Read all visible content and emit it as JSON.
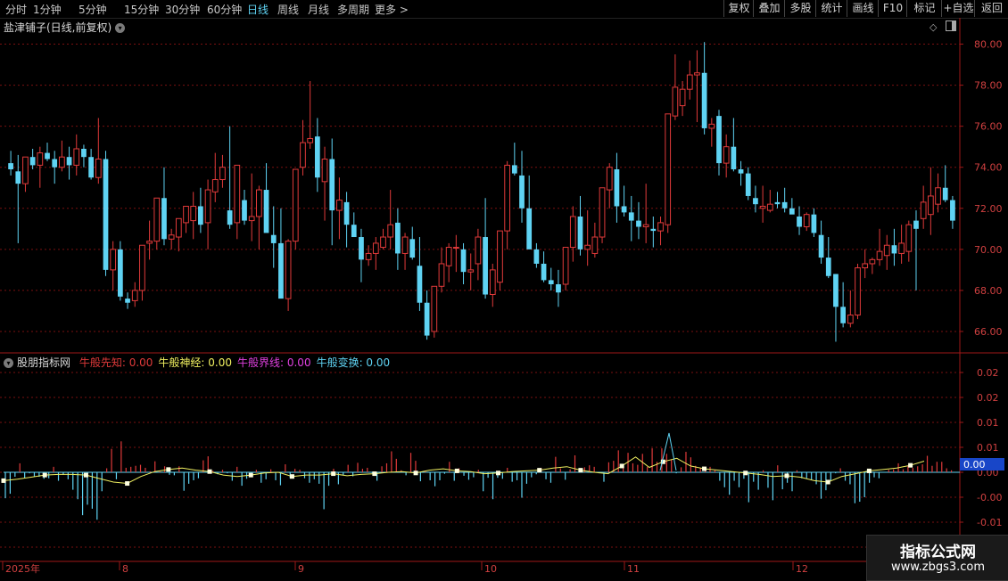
{
  "toolbar": {
    "periods": [
      "分时",
      "1分钟",
      "5分钟",
      "15分钟",
      "30分钟",
      "60分钟",
      "日线",
      "周线",
      "月线",
      "多周期",
      "更多 >"
    ],
    "active_period": "日线",
    "right_buttons": [
      "复权",
      "叠加",
      "多股",
      "统计",
      "画线",
      "F10",
      "标记",
      "+自选",
      "返回"
    ]
  },
  "stock": {
    "title": "盐津铺子(日线,前复权)"
  },
  "price_axis": [
    "80.00",
    "78.00",
    "76.00",
    "74.00",
    "72.00",
    "70.00",
    "68.00",
    "66.00"
  ],
  "indicator": {
    "name": "股朋指标网",
    "items": [
      {
        "label": "牛般先知: 0.00",
        "color": "#e03a3a"
      },
      {
        "label": "牛般神经: 0.00",
        "color": "#f0f060"
      },
      {
        "label": "牛般界线: 0.00",
        "color": "#e040e0"
      },
      {
        "label": "牛般变换: 0.00",
        "color": "#5fd3f3"
      }
    ],
    "axis": [
      "0.02",
      "0.02",
      "0.01",
      "0.01",
      "0.00",
      "-0.00",
      "-0.01",
      "-0.01"
    ],
    "current_value": "0.00"
  },
  "date_axis": [
    "2025年",
    "8",
    "9",
    "10",
    "11",
    "12"
  ],
  "watermark": {
    "line1": "指标公式网",
    "line2": "www.zbgs3.com"
  },
  "colors": {
    "up": "#e03a3a",
    "down": "#5fd3f3",
    "grid": "#7a1010",
    "accent": "#5fd3f3"
  },
  "chart_data": {
    "type": "candlestick",
    "ylim": [
      65.0,
      80.5
    ],
    "candles": [
      [
        74.2,
        74.8,
        73.6,
        73.9
      ],
      [
        73.8,
        74.6,
        70.3,
        73.2
      ],
      [
        73.2,
        74.5,
        72.8,
        74.5
      ],
      [
        74.5,
        74.9,
        73.9,
        74.1
      ],
      [
        74.1,
        75.0,
        73.0,
        74.7
      ],
      [
        74.7,
        75.2,
        74.3,
        74.4
      ],
      [
        74.4,
        74.8,
        73.2,
        74.0
      ],
      [
        74.0,
        75.3,
        73.8,
        74.5
      ],
      [
        74.5,
        75.0,
        73.4,
        74.1
      ],
      [
        74.1,
        75.6,
        73.6,
        74.9
      ],
      [
        74.9,
        75.1,
        74.0,
        74.5
      ],
      [
        74.5,
        74.9,
        73.4,
        73.5
      ],
      [
        73.5,
        76.4,
        73.2,
        74.4
      ],
      [
        74.4,
        74.8,
        68.7,
        69.0
      ],
      [
        69.0,
        70.4,
        68.0,
        70.0
      ],
      [
        70.0,
        70.4,
        67.5,
        67.7
      ],
      [
        67.6,
        67.9,
        67.1,
        67.4
      ],
      [
        67.5,
        68.4,
        67.2,
        68.0
      ],
      [
        68.0,
        69.5,
        67.5,
        70.2
      ],
      [
        70.3,
        71.4,
        69.5,
        70.4
      ],
      [
        70.4,
        72.5,
        70.0,
        72.5
      ],
      [
        72.5,
        74.0,
        70.2,
        70.5
      ],
      [
        70.5,
        71.0,
        70.0,
        70.7
      ],
      [
        70.6,
        71.4,
        69.9,
        71.5
      ],
      [
        71.3,
        72.0,
        70.8,
        72.1
      ],
      [
        71.4,
        72.8,
        70.5,
        72.1
      ],
      [
        72.1,
        73.0,
        70.8,
        71.2
      ],
      [
        71.3,
        73.4,
        70.0,
        72.9
      ],
      [
        72.8,
        74.7,
        72.3,
        73.4
      ],
      [
        73.4,
        74.6,
        73.0,
        74.0
      ],
      [
        71.9,
        76.0,
        71.0,
        71.2
      ],
      [
        71.3,
        74.0,
        70.5,
        74.1
      ],
      [
        72.4,
        72.9,
        71.2,
        71.4
      ],
      [
        71.4,
        73.7,
        70.4,
        71.6
      ],
      [
        71.6,
        73.1,
        70.0,
        72.9
      ],
      [
        72.9,
        74.2,
        71.8,
        70.8
      ],
      [
        70.7,
        72.1,
        69.1,
        70.3
      ],
      [
        70.3,
        72.0,
        68.0,
        67.6
      ],
      [
        67.6,
        70.5,
        67.0,
        70.4
      ],
      [
        70.4,
        73.9,
        70.0,
        73.9
      ],
      [
        74.0,
        76.3,
        73.6,
        75.2
      ],
      [
        75.2,
        78.2,
        74.9,
        75.4
      ],
      [
        75.5,
        76.4,
        72.8,
        73.5
      ],
      [
        73.3,
        75.0,
        71.4,
        74.4
      ],
      [
        74.4,
        75.4,
        70.2,
        71.9
      ],
      [
        71.9,
        73.5,
        70.5,
        72.4
      ],
      [
        72.3,
        72.8,
        70.1,
        71.2
      ],
      [
        71.2,
        71.8,
        70.8,
        70.6
      ],
      [
        70.6,
        71.0,
        68.4,
        69.5
      ],
      [
        69.5,
        70.2,
        69.2,
        69.8
      ],
      [
        69.8,
        70.6,
        69.0,
        70.3
      ],
      [
        70.1,
        71.0,
        70.0,
        70.6
      ],
      [
        70.6,
        72.9,
        70.0,
        71.2
      ],
      [
        71.3,
        72.0,
        69.0,
        69.8
      ],
      [
        69.8,
        70.8,
        69.0,
        70.6
      ],
      [
        70.5,
        71.1,
        69.5,
        69.6
      ],
      [
        69.2,
        70.6,
        67.0,
        67.4
      ],
      [
        67.4,
        68.0,
        65.6,
        65.8
      ],
      [
        66.0,
        68.0,
        65.7,
        68.2
      ],
      [
        68.2,
        70.1,
        67.9,
        69.3
      ],
      [
        69.2,
        70.3,
        68.4,
        70.1
      ],
      [
        70.1,
        70.7,
        68.9,
        70.1
      ],
      [
        70.0,
        70.3,
        68.3,
        68.9
      ],
      [
        68.9,
        69.8,
        68.0,
        69.0
      ],
      [
        69.3,
        71.0,
        68.5,
        70.6
      ],
      [
        70.6,
        72.5,
        67.6,
        67.8
      ],
      [
        67.8,
        69.3,
        67.2,
        69.0
      ],
      [
        68.4,
        70.9,
        68.0,
        70.9
      ],
      [
        70.9,
        74.3,
        70.0,
        74.1
      ],
      [
        74.1,
        75.2,
        73.6,
        73.7
      ],
      [
        73.6,
        74.8,
        71.3,
        72.0
      ],
      [
        72.0,
        73.6,
        70.6,
        70.0
      ],
      [
        70.0,
        70.3,
        69.1,
        69.3
      ],
      [
        69.3,
        69.9,
        68.4,
        68.5
      ],
      [
        68.5,
        69.1,
        68.0,
        68.3
      ],
      [
        68.3,
        69.0,
        67.2,
        67.9
      ],
      [
        68.3,
        70.1,
        68.0,
        70.1
      ],
      [
        70.1,
        72.1,
        69.4,
        71.6
      ],
      [
        71.6,
        72.6,
        69.7,
        70.0
      ],
      [
        70.0,
        71.9,
        69.2,
        70.2
      ],
      [
        69.8,
        71.3,
        69.6,
        70.6
      ],
      [
        70.6,
        73.0,
        70.3,
        73.0
      ],
      [
        72.9,
        74.2,
        72.0,
        74.0
      ],
      [
        73.9,
        74.7,
        71.3,
        72.1
      ],
      [
        72.1,
        73.1,
        71.6,
        71.8
      ],
      [
        71.8,
        72.6,
        70.4,
        71.4
      ],
      [
        71.4,
        72.3,
        70.5,
        71.1
      ],
      [
        71.1,
        73.2,
        70.3,
        71.2
      ],
      [
        71.0,
        71.6,
        70.1,
        70.9
      ],
      [
        70.9,
        71.6,
        70.2,
        71.3
      ],
      [
        71.2,
        76.6,
        70.8,
        76.6
      ],
      [
        76.5,
        79.5,
        76.3,
        77.9
      ],
      [
        77.0,
        78.2,
        76.5,
        77.8
      ],
      [
        77.8,
        79.2,
        77.3,
        78.5
      ],
      [
        78.5,
        79.7,
        76.2,
        78.6
      ],
      [
        78.6,
        80.1,
        75.6,
        75.9
      ],
      [
        75.9,
        76.4,
        75.0,
        76.1
      ],
      [
        76.5,
        76.8,
        73.6,
        74.2
      ],
      [
        74.2,
        75.6,
        73.5,
        75.0
      ],
      [
        75.0,
        76.4,
        73.8,
        73.9
      ],
      [
        73.9,
        74.3,
        73.1,
        73.7
      ],
      [
        73.7,
        74.0,
        72.4,
        72.6
      ],
      [
        72.5,
        73.1,
        71.8,
        72.2
      ],
      [
        72.0,
        73.1,
        71.3,
        72.1
      ],
      [
        71.9,
        72.9,
        71.8,
        72.2
      ],
      [
        72.3,
        72.8,
        72.0,
        72.2
      ],
      [
        72.3,
        73.0,
        71.8,
        72.0
      ],
      [
        72.0,
        72.5,
        71.9,
        71.7
      ],
      [
        71.6,
        72.1,
        70.7,
        71.1
      ],
      [
        71.1,
        71.8,
        70.9,
        71.7
      ],
      [
        71.7,
        72.0,
        70.6,
        70.8
      ],
      [
        70.7,
        71.4,
        69.3,
        69.6
      ],
      [
        69.6,
        70.6,
        68.6,
        68.7
      ],
      [
        68.8,
        68.8,
        65.5,
        67.2
      ],
      [
        67.2,
        68.4,
        66.2,
        66.4
      ],
      [
        66.4,
        68.0,
        66.2,
        66.8
      ],
      [
        66.8,
        69.3,
        66.6,
        69.1
      ],
      [
        69.1,
        70.0,
        68.6,
        69.3
      ],
      [
        69.3,
        69.6,
        68.8,
        69.5
      ],
      [
        69.5,
        71.0,
        69.2,
        69.9
      ],
      [
        69.7,
        70.7,
        69.0,
        70.2
      ],
      [
        70.2,
        71.0,
        69.2,
        69.8
      ],
      [
        69.8,
        71.2,
        69.3,
        70.3
      ],
      [
        69.9,
        71.4,
        69.4,
        71.2
      ],
      [
        71.4,
        71.9,
        68.0,
        71.0
      ],
      [
        71.5,
        73.1,
        71.0,
        72.3
      ],
      [
        71.7,
        74.0,
        70.7,
        72.6
      ],
      [
        72.2,
        73.7,
        71.8,
        73.0
      ],
      [
        73.0,
        74.1,
        72.3,
        72.4
      ],
      [
        72.4,
        72.6,
        71.0,
        71.4
      ]
    ],
    "sub_bars": [
      -0.0052,
      -0.0043,
      -0.0009,
      0.0018,
      -0.0011,
      -0.0002,
      -0.0008,
      -0.0009,
      -0.0013,
      -0.0012,
      0.0011,
      -0.0017,
      -0.0005,
      -0.0014,
      -0.0035,
      -0.0054,
      -0.0086,
      -0.0065,
      -0.0073,
      -0.0095,
      -0.0038,
      0.0008,
      0.0047,
      -0.0014,
      0.0062,
      0.0009,
      0.0011,
      0.0013,
      0.0015,
      0.0009,
      0.0002,
      0.0022,
      0.0002,
      0.0012,
      -0.0005,
      -0.0006,
      0.0012,
      -0.0037,
      -0.0023,
      -0.0016,
      -0.0012,
      0.0024,
      0.0032,
      0.0003,
      -0.0004,
      0.0005,
      -0.0002,
      -0.0017,
      0.0011,
      -0.0027,
      -0.0013,
      -0.0006,
      0.0005,
      -0.0021,
      -0.0014,
      0.0006,
      -0.0016,
      -0.0026,
      0.0016,
      -0.0012,
      0.0007,
      0.0005,
      -0.0012,
      -0.0021,
      -0.0014,
      -0.0023,
      -0.0074,
      -0.0027,
      0.0007,
      -0.0024,
      -0.0006,
      0.0015,
      -0.0008,
      0.0019,
      0.0007,
      0.0009,
      -0.0002,
      -0.0017,
      0.0012,
      0.0018,
      0.0042,
      0.0027,
      0.0004,
      -0.0006,
      0.0039,
      0.0023,
      -0.0018,
      0.0003,
      -0.0016,
      -0.0028,
      -0.0016,
      -0.0003,
      0.0021,
      -0.0017,
      0.0008,
      -0.0007,
      -0.0015,
      -0.001,
      0.0005,
      -0.0038,
      -0.0011,
      -0.0054,
      -0.0011,
      -0.0013,
      0.0009,
      -0.0019,
      -0.0016,
      -0.0051,
      -0.0023,
      -0.001,
      -0.0004,
      0.0009,
      -0.0014,
      -0.0021,
      0.0031,
      0.0008,
      -0.0015,
      0.0006,
      0.0034,
      0.0006,
      0.001,
      0.0014,
      0.0011,
      -0.0002,
      -0.0019,
      0.002,
      0.0023,
      0.0044,
      0.0016,
      0.0039,
      0.0018,
      0.0015,
      0.0037,
      0.0011,
      0.0048,
      0.0021,
      0.0048,
      0.0037,
      0.0026,
      -0.0002,
      0.001,
      0.0041,
      0.003,
      0.0013,
      0.0009,
      0.0006,
      0.0011,
      0.0004,
      -0.0017,
      -0.003,
      -0.0045,
      -0.0017,
      -0.003,
      -0.0013,
      -0.006,
      -0.0019,
      -0.0035,
      0.0004,
      -0.0031,
      -0.0056,
      0.0014,
      -0.0034,
      -0.0021,
      -0.0038,
      0.0004,
      -0.0012,
      -0.0012,
      -0.0015,
      -0.0024,
      -0.0053,
      -0.0036,
      -0.0016,
      -0.0002,
      0.0008,
      -0.0017,
      -0.0024,
      -0.0062,
      -0.0059,
      -0.005,
      -0.0021,
      -0.001,
      -0.0012,
      0.0,
      0.0005,
      0.0006,
      0.0018,
      0.0006,
      0.0012,
      0.0009,
      0.0012,
      0.0016,
      0.0033,
      0.0013,
      0.0021,
      0.0021,
      0.0008,
      0.0004
    ],
    "line": [
      -0.0012,
      -0.001,
      -0.0007,
      -0.0004,
      -0.0003,
      -0.0003,
      -0.0004,
      -0.0009,
      -0.0014,
      -0.0016,
      -0.0006,
      0.0001,
      0.0004,
      0.0006,
      0.0003,
      0.0001,
      -0.0004,
      -0.0006,
      -0.0004,
      -0.0001,
      0.0,
      -0.0006,
      -0.0004,
      -0.0004,
      -0.0002,
      -0.0005,
      -0.0003,
      -0.0002,
      0.0,
      0.0001,
      -0.0001,
      0.0003,
      0.0005,
      0.0002,
      0.0001,
      -0.0002,
      -0.0001,
      0.0001,
      0.0002,
      0.0003,
      0.0006,
      0.0008,
      0.0003,
      0.0,
      -0.0002,
      0.0009,
      0.0022,
      0.0007,
      0.0015,
      0.002,
      0.0009,
      0.0005,
      0.0003,
      0.0001,
      -0.0001,
      -0.0003,
      -0.0006,
      -0.0005,
      -0.0007,
      -0.0012,
      -0.0014,
      -0.0006,
      -0.0002,
      0.0002,
      0.0004,
      0.0006,
      0.001,
      0.0016
    ]
  }
}
